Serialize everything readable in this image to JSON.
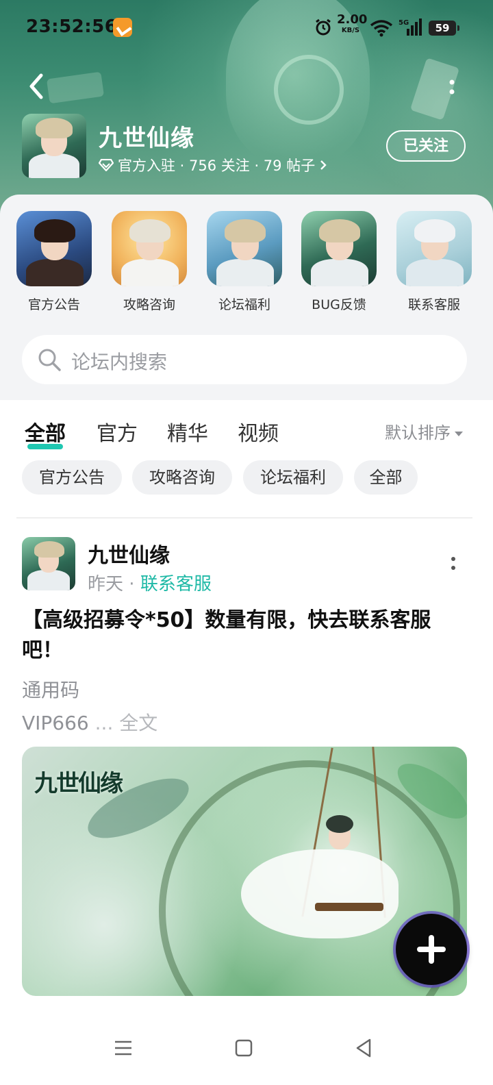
{
  "status_bar": {
    "time": "23:52:56",
    "net_speed_value": "2.00",
    "net_speed_unit": "KB/S",
    "network_type": "5G",
    "battery": "59"
  },
  "header": {
    "forum_title": "九世仙缘",
    "meta": "官方入驻 · 756 关注 · 79 帖子",
    "follow_button": "已关注"
  },
  "categories": [
    {
      "label": "官方公告"
    },
    {
      "label": "攻略咨询"
    },
    {
      "label": "论坛福利"
    },
    {
      "label": "BUG反馈"
    },
    {
      "label": "联系客服"
    }
  ],
  "search": {
    "placeholder": "论坛内搜索"
  },
  "tabs": [
    {
      "label": "全部",
      "active": true
    },
    {
      "label": "官方"
    },
    {
      "label": "精华"
    },
    {
      "label": "视频"
    }
  ],
  "sort": {
    "label": "默认排序"
  },
  "chips": [
    {
      "label": "官方公告"
    },
    {
      "label": "攻略咨询"
    },
    {
      "label": "论坛福利"
    },
    {
      "label": "全部"
    }
  ],
  "post": {
    "author": "九世仙缘",
    "time": "昨天",
    "separator": " · ",
    "category": "联系客服",
    "title": "【高级招募令*50】数量有限，快去联系客服吧！",
    "body_line1": "通用码",
    "body_line2": "VIP666",
    "more_text": " ... 全文",
    "image_logo": "九世仙缘"
  },
  "colors": {
    "accent": "#20c7b1",
    "category_tag": "#1fb9a6",
    "hero_green": "#3c8c72"
  }
}
